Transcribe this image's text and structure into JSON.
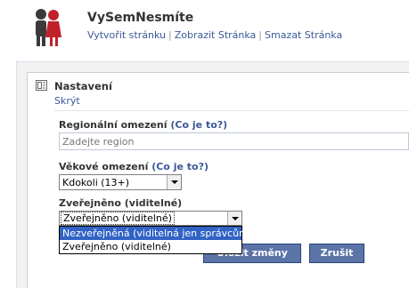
{
  "header": {
    "app_title": "VySemNesmíte",
    "links": [
      "Vytvořit stránku",
      "Zobrazit Stránka",
      "Smazat Stránka"
    ],
    "separator": "|"
  },
  "panel": {
    "title": "Nastavení",
    "hide_link": "Skrýt"
  },
  "form": {
    "region": {
      "label": "Regionální omezení",
      "help": "(Co je to?)",
      "placeholder": "Zadejte region"
    },
    "age": {
      "label": "Věkové omezení",
      "help": "(Co je to?)",
      "value": "Kdokoli (13+)"
    },
    "published": {
      "label": "Zveřejněno (viditelné)",
      "value": "Zveřejněno (viditelné)",
      "options": [
        "Nezveřejněná (viditelná jen správcům)",
        "Zveřejněno (viditelné)"
      ],
      "highlighted_option": "Nezveřejněná (viditelná jen správcům)"
    },
    "buttons": {
      "save": "Uložit změny",
      "cancel": "Zrušit"
    }
  },
  "colors": {
    "link": "#3b5998",
    "button_bg": "#5b74a8",
    "highlight": "#3163c5"
  },
  "icons": [
    "people-avatar-icon",
    "settings-panel-icon",
    "dropdown-arrow-icon"
  ]
}
